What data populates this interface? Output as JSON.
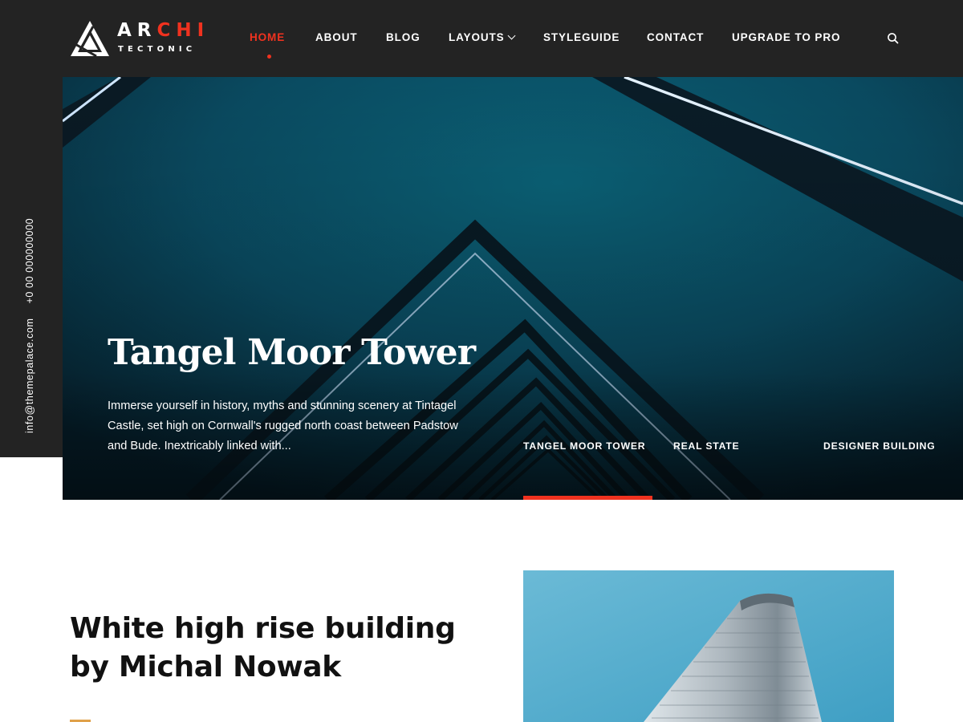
{
  "brand": {
    "word1_part1": "AR",
    "word1_part2": "CHI",
    "word2": "TECTONIC",
    "accent_color": "#f0321f",
    "dark_color": "#232323"
  },
  "nav": {
    "items": [
      {
        "label": "HOME",
        "active": true
      },
      {
        "label": "ABOUT",
        "active": false
      },
      {
        "label": "BLOG",
        "active": false
      },
      {
        "label": "LAYOUTS",
        "active": false,
        "has_dropdown": true
      },
      {
        "label": "STYLEGUIDE",
        "active": false
      },
      {
        "label": "CONTACT",
        "active": false
      },
      {
        "label": "UPGRADE TO PRO",
        "active": false
      }
    ],
    "search_icon": "search-icon"
  },
  "sidebar": {
    "email": "info@themepalace.com",
    "phone": "+0 00 000000000"
  },
  "hero": {
    "title": "Tangel Moor Tower",
    "description": "Immerse yourself in history, myths and stunning scenery at Tintagel Castle, set high on Cornwall's rugged north coast between Padstow and Bude. Inextricably linked with...",
    "slides": [
      "TANGEL MOOR TOWER",
      "REAL STATE",
      "DESIGNER BUILDING"
    ],
    "active_slide": 0
  },
  "post": {
    "title": "White high rise building by Michal Nowak"
  }
}
